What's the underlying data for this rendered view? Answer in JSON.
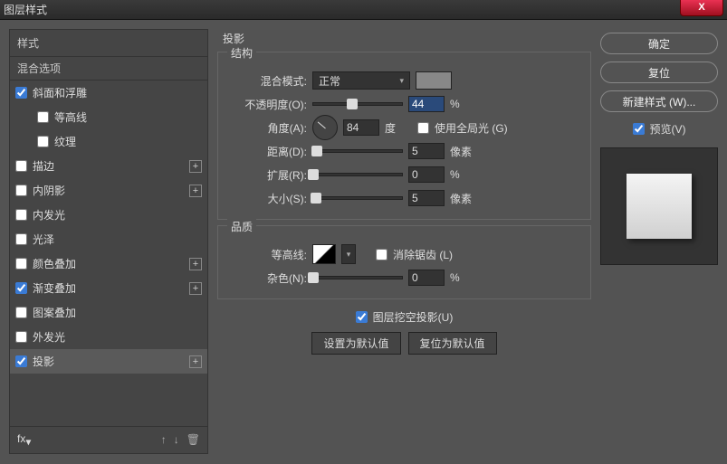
{
  "window": {
    "title": "图层样式"
  },
  "sidebar": {
    "header": "样式",
    "subheader": "混合选项",
    "items": [
      {
        "label": "斜面和浮雕",
        "checked": true,
        "plus": false,
        "indent": false
      },
      {
        "label": "等高线",
        "checked": false,
        "plus": false,
        "indent": true
      },
      {
        "label": "纹理",
        "checked": false,
        "plus": false,
        "indent": true
      },
      {
        "label": "描边",
        "checked": false,
        "plus": true,
        "indent": false
      },
      {
        "label": "内阴影",
        "checked": false,
        "plus": true,
        "indent": false
      },
      {
        "label": "内发光",
        "checked": false,
        "plus": false,
        "indent": false
      },
      {
        "label": "光泽",
        "checked": false,
        "plus": false,
        "indent": false
      },
      {
        "label": "颜色叠加",
        "checked": false,
        "plus": true,
        "indent": false
      },
      {
        "label": "渐变叠加",
        "checked": true,
        "plus": true,
        "indent": false
      },
      {
        "label": "图案叠加",
        "checked": false,
        "plus": false,
        "indent": false
      },
      {
        "label": "外发光",
        "checked": false,
        "plus": false,
        "indent": false
      },
      {
        "label": "投影",
        "checked": true,
        "plus": true,
        "indent": false,
        "selected": true
      }
    ],
    "fx_label": "fx"
  },
  "panel": {
    "title": "投影",
    "structure": {
      "legend": "结构",
      "blend_label": "混合模式:",
      "blend_value": "正常",
      "opacity_label": "不透明度(O):",
      "opacity_value": "44",
      "opacity_unit": "%",
      "angle_label": "角度(A):",
      "angle_value": "84",
      "angle_unit": "度",
      "global_label": "使用全局光 (G)",
      "distance_label": "距离(D):",
      "distance_value": "5",
      "distance_unit": "像素",
      "spread_label": "扩展(R):",
      "spread_value": "0",
      "spread_unit": "%",
      "size_label": "大小(S):",
      "size_value": "5",
      "size_unit": "像素"
    },
    "quality": {
      "legend": "品质",
      "contour_label": "等高线:",
      "antialias_label": "消除锯齿 (L)",
      "noise_label": "杂色(N):",
      "noise_value": "0",
      "noise_unit": "%"
    },
    "knockout_label": "图层挖空投影(U)",
    "set_default": "设置为默认值",
    "reset_default": "复位为默认值"
  },
  "buttons": {
    "ok": "确定",
    "reset": "复位",
    "new_style": "新建样式 (W)...",
    "preview": "预览(V)"
  }
}
